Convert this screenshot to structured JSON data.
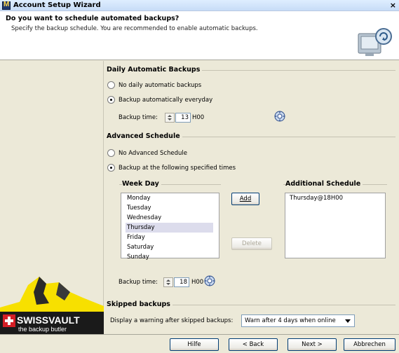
{
  "window": {
    "title": "Account Setup Wizard",
    "close_label": "×"
  },
  "header": {
    "question": "Do you want to schedule automated backups?",
    "subtitle": "Specify the backup schedule. You are recommended to enable automatic backups.",
    "icon": "backup-monitor-icon"
  },
  "logo": {
    "name": "SWISSVAULT",
    "tagline": "the backup butler"
  },
  "daily": {
    "title": "Daily Automatic Backups",
    "options": [
      {
        "label": "No daily automatic backups",
        "checked": false
      },
      {
        "label": "Backup automatically everyday",
        "checked": true
      }
    ],
    "backup_time_label": "Backup time:",
    "hour": "13",
    "suffix": "H00"
  },
  "advanced": {
    "title": "Advanced Schedule",
    "options": [
      {
        "label": "No Advanced Schedule",
        "checked": false
      },
      {
        "label": "Backup at the following specified times",
        "checked": true
      }
    ],
    "weekday_title": "Week Day",
    "weekdays": [
      "Monday",
      "Tuesday",
      "Wednesday",
      "Thursday",
      "Friday",
      "Saturday",
      "Sunday"
    ],
    "selected_weekday": "Thursday",
    "add_label": "Add",
    "delete_label": "Delete",
    "additional_title": "Additional Schedule",
    "additional_items": [
      "Thursday@18H00"
    ],
    "backup_time_label": "Backup time:",
    "hour": "18",
    "suffix": "H00"
  },
  "skipped": {
    "title": "Skipped backups",
    "label": "Display a warning after skipped backups:",
    "selected": "Warn after 4 days when online"
  },
  "buttons": {
    "help": "Hilfe",
    "back": "< Back",
    "next": "Next >",
    "cancel": "Abbrechen"
  },
  "colors": {
    "accent": "#003c74",
    "selection": "#dcdcec",
    "logo_yellow": "#f7e000",
    "swiss_red": "#d41f26"
  }
}
